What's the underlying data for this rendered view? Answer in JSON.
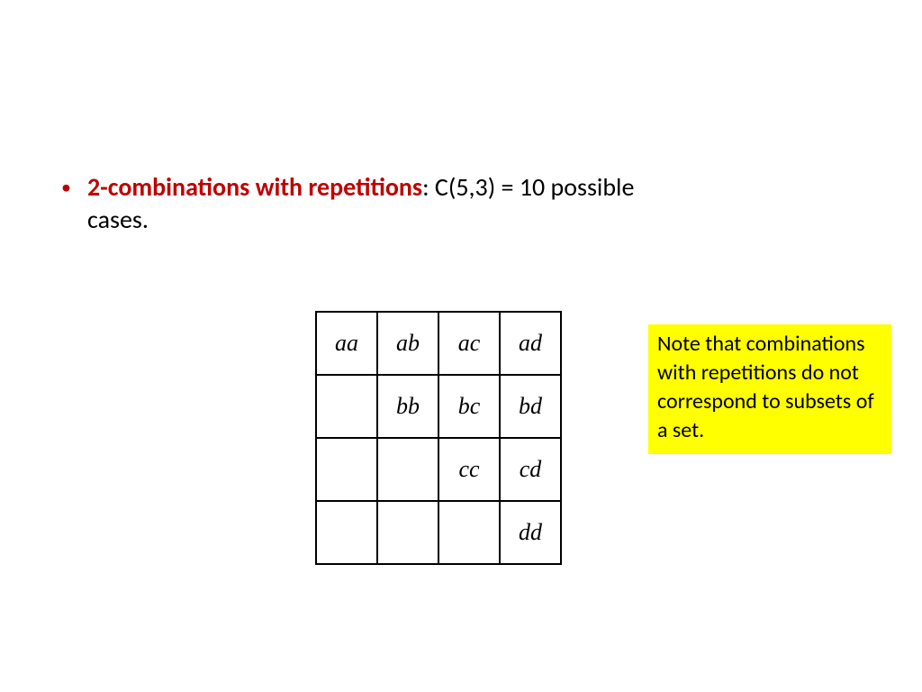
{
  "bullet": {
    "title_bold": "2-combinations with  repetitions",
    "title_rest": ": C(5,3) = 10 possible cases."
  },
  "table": {
    "rows": [
      [
        "aa",
        "ab",
        "ac",
        "ad"
      ],
      [
        "",
        "bb",
        "bc",
        "bd"
      ],
      [
        "",
        "",
        "cc",
        "cd"
      ],
      [
        "",
        "",
        "",
        "dd"
      ]
    ]
  },
  "note": {
    "text": "Note that combinations with repetitions do not correspond to subsets of a set."
  }
}
